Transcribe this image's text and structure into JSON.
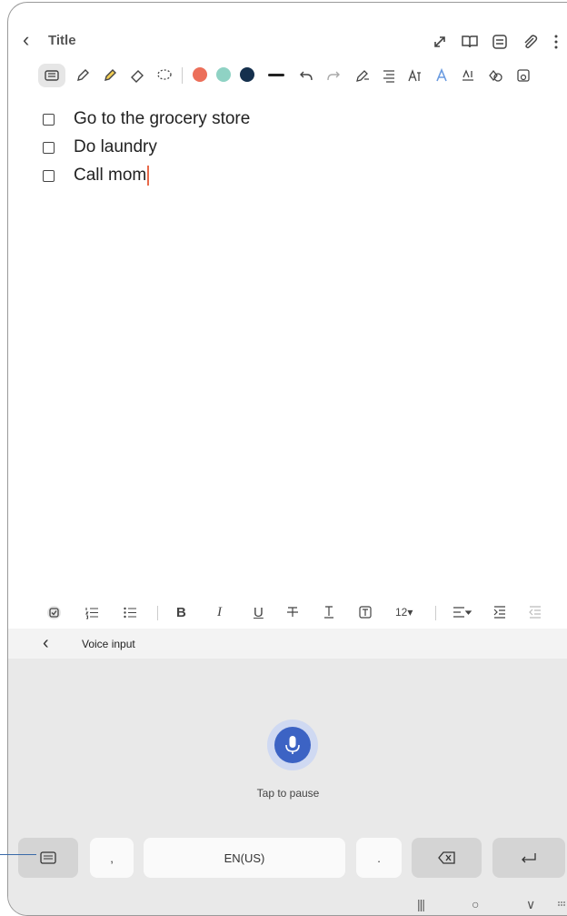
{
  "title_bar": {
    "back_glyph": "‹",
    "title": "Title"
  },
  "checklist": [
    {
      "text": "Go to the grocery store"
    },
    {
      "text": "Do laundry"
    },
    {
      "text": "Call mom"
    }
  ],
  "pen_colors": [
    "#ec6f5a",
    "#8fd2c4",
    "#15304d"
  ],
  "format_bar": {
    "bold": "B",
    "italic": "I",
    "underline": "U",
    "font_size": "12▾"
  },
  "voice": {
    "back_glyph": "‹",
    "label": "Voice input",
    "status": "Tap to pause"
  },
  "keyboard": {
    "comma": ",",
    "language": "EN(US)",
    "period": "."
  },
  "nav_bar": {
    "recents": "|||",
    "home": "○",
    "back": "∨"
  }
}
